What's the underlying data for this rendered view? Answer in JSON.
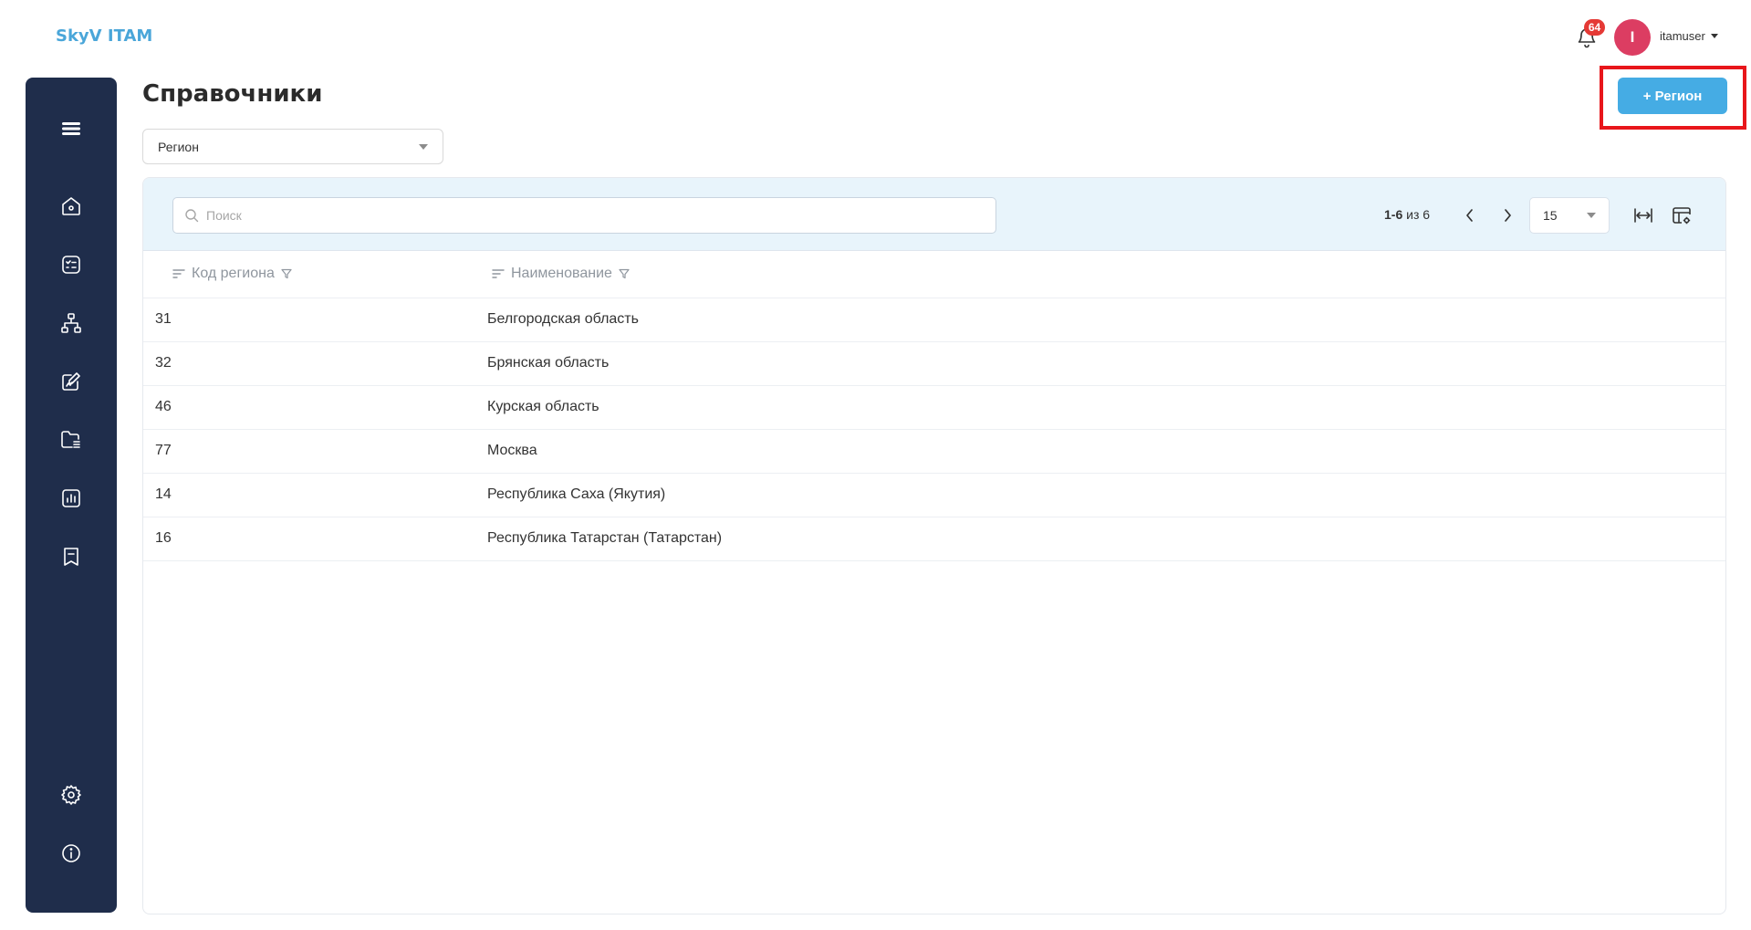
{
  "app": {
    "logo": "SkyV ITAM"
  },
  "header": {
    "notifications_count": "64",
    "avatar_initial": "I",
    "username": "itamuser"
  },
  "sidebar": {
    "items": [
      {
        "icon": "menu-icon"
      },
      {
        "icon": "home-icon"
      },
      {
        "icon": "checklist-icon"
      },
      {
        "icon": "network-icon"
      },
      {
        "icon": "edit-document-icon"
      },
      {
        "icon": "folder-list-icon"
      },
      {
        "icon": "chart-icon"
      },
      {
        "icon": "bookmark-icon"
      },
      {
        "icon": "gear-icon"
      },
      {
        "icon": "info-icon"
      }
    ]
  },
  "main": {
    "title": "Справочники",
    "dictionary_select": {
      "value": "Регион"
    },
    "add_button": "+ Регион"
  },
  "table": {
    "search_placeholder": "Поиск",
    "pagination": {
      "range": "1-6",
      "of_label": "из 6"
    },
    "per_page": "15",
    "columns": [
      "Код региона",
      "Наименование"
    ],
    "rows": [
      {
        "code": "31",
        "name": "Белгородская область"
      },
      {
        "code": "32",
        "name": "Брянская область"
      },
      {
        "code": "46",
        "name": "Курская область"
      },
      {
        "code": "77",
        "name": "Москва"
      },
      {
        "code": "14",
        "name": "Республика Саха (Якутия)"
      },
      {
        "code": "16",
        "name": "Республика Татарстан (Татарстан)"
      }
    ]
  },
  "colors": {
    "sidebar_bg": "#1f2d4b",
    "accent": "#45ace4",
    "highlight": "#e8161b",
    "badge": "#e53935",
    "avatar": "#dc3d62"
  }
}
